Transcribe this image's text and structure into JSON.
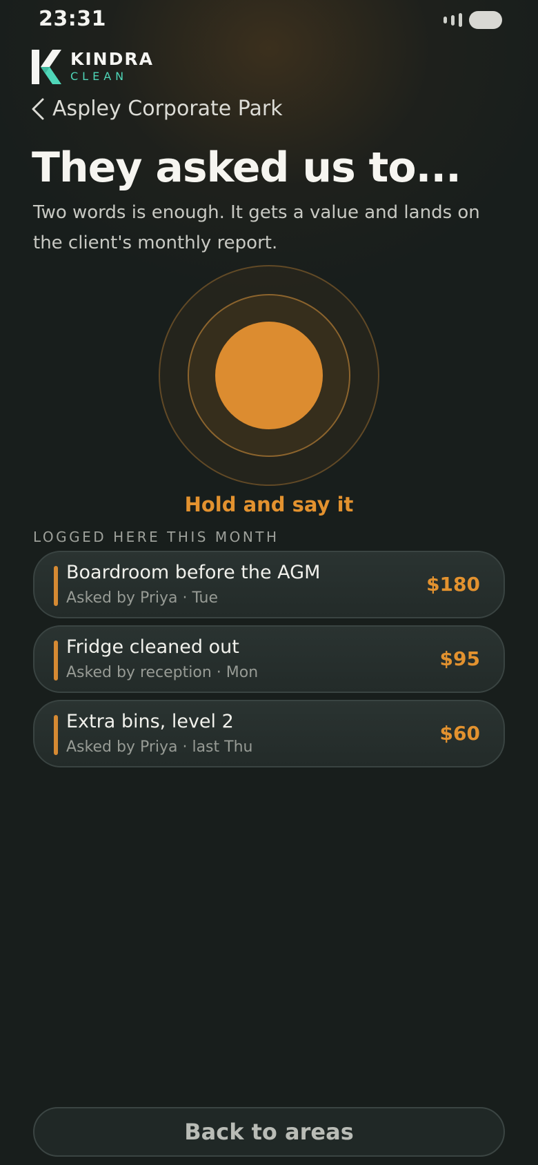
{
  "status_bar": {
    "time": "23:31"
  },
  "brand": {
    "name": "KINDRA",
    "sub": "CLEAN",
    "accent_color": "#4fd6b8"
  },
  "nav": {
    "back_label": "Aspley Corporate Park"
  },
  "header": {
    "title": "They asked us to...",
    "subtitle": "Two words is enough. It gets a value and lands on the client's monthly report."
  },
  "recorder": {
    "hold_label": "Hold and say it",
    "accent_color": "#dc8c30"
  },
  "log": {
    "section_label": "LOGGED HERE THIS MONTH",
    "items": [
      {
        "title": "Boardroom before the AGM",
        "meta": "Asked by Priya · Tue",
        "value": "$180"
      },
      {
        "title": "Fridge cleaned out",
        "meta": "Asked by reception · Mon",
        "value": "$95"
      },
      {
        "title": "Extra bins, level 2",
        "meta": "Asked by Priya · last Thu",
        "value": "$60"
      }
    ]
  },
  "footer": {
    "back_button_label": "Back to areas"
  }
}
